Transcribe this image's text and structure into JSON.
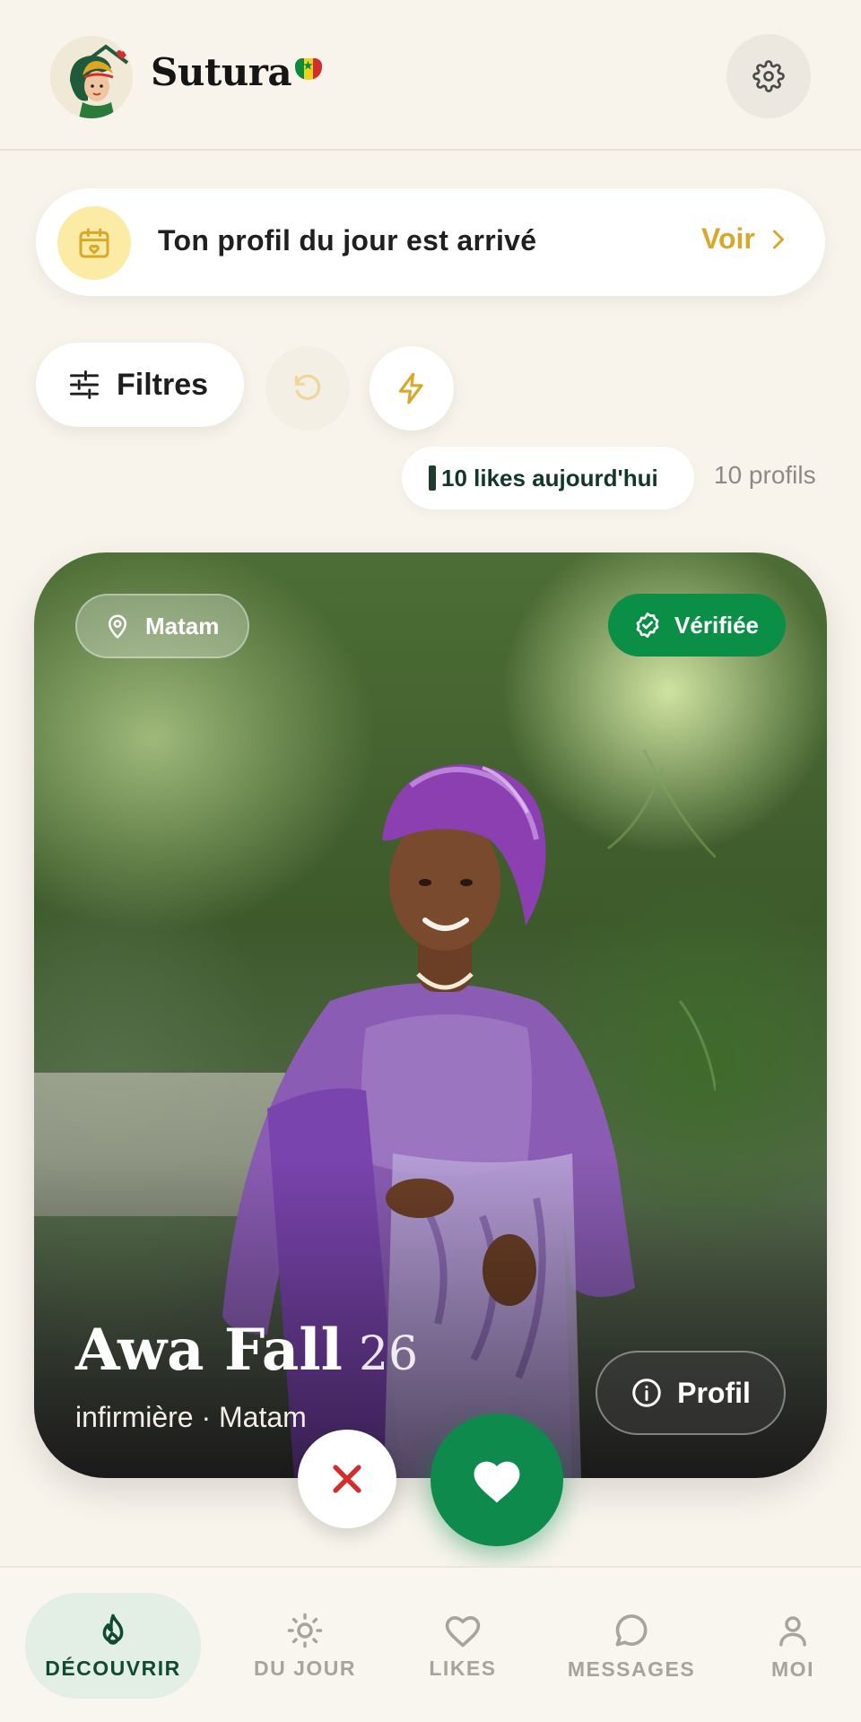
{
  "app": {
    "brand": "Sutura",
    "logo_icon": "woman-house-logo",
    "settings_icon": "gear-icon"
  },
  "daily_banner": {
    "icon": "calendar-heart-icon",
    "text": "Ton profil du jour est arrivé",
    "link_label": "Voir"
  },
  "toolbar": {
    "filters_label": "Filtres",
    "undo_icon": "undo-icon",
    "boost_icon": "lightning-icon"
  },
  "stats": {
    "likes_today": "10 likes aujourd'hui",
    "profiles_count": "10 profils"
  },
  "card": {
    "location_badge": "Matam",
    "verified_badge": "Vérifiée",
    "name": "Awa Fall",
    "age": "26",
    "job_location": "infirmière · Matam",
    "profile_button": "Profil"
  },
  "actions": {
    "pass_icon": "close-icon",
    "like_icon": "heart-icon"
  },
  "nav": {
    "items": [
      {
        "label": "DÉCOUVRIR",
        "icon": "flame-icon",
        "active": true
      },
      {
        "label": "DU JOUR",
        "icon": "sun-icon",
        "active": false
      },
      {
        "label": "LIKES",
        "icon": "heart-icon",
        "active": false
      },
      {
        "label": "MESSAGES",
        "icon": "chat-bubble-icon",
        "active": false
      },
      {
        "label": "MOI",
        "icon": "user-icon",
        "active": false
      }
    ]
  },
  "colors": {
    "background": "#f8f4ec",
    "accent_green": "#0e8a4d",
    "accent_gold": "#d9a82b",
    "pass_red": "#d32d2d"
  }
}
